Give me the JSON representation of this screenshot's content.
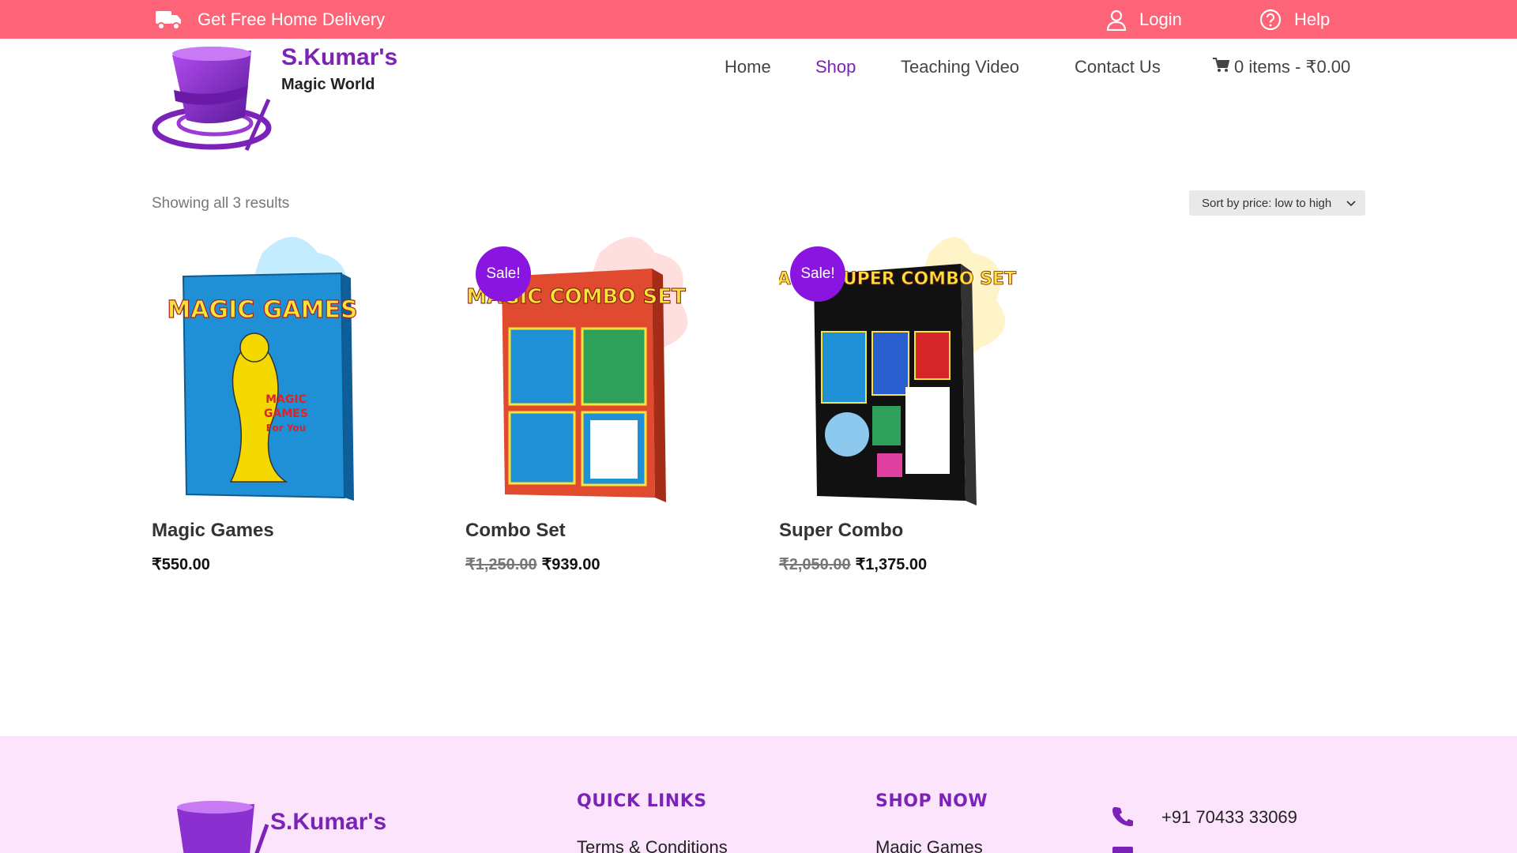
{
  "topbar": {
    "delivery_text": "Get Free Home Delivery",
    "login_label": "Login",
    "help_label": "Help",
    "background": "#fd6477"
  },
  "header": {
    "brand_name": "S.Kumar's",
    "brand_sub": "Magic World"
  },
  "nav": {
    "items": [
      "Home",
      "Shop",
      "Teaching Video",
      "Contact Us"
    ],
    "active": "Shop",
    "cart_label": "0 items - ₹0.00"
  },
  "shop": {
    "results_count": "Showing all 3 results",
    "sort_selected": "Sort by price: low to high"
  },
  "products": [
    {
      "name": "Magic Games",
      "price": "₹550.00",
      "old_price": "",
      "sale": false,
      "box_title": "MAGIC GAMES"
    },
    {
      "name": "Combo Set",
      "price": "₹939.00",
      "old_price": "₹1,250.00",
      "sale": true,
      "sale_label": "Sale!",
      "box_title": "MAGIC COMBO SET"
    },
    {
      "name": "Super Combo",
      "price": "₹1,375.00",
      "old_price": "₹2,050.00",
      "sale": true,
      "sale_label": "Sale!",
      "box_title": "MAGIC SUPER COMBO SET"
    }
  ],
  "footer": {
    "brand_name": "S.Kumar's",
    "quick_links_title": "QUICK LINKS",
    "quick_links": [
      "Terms & Conditions"
    ],
    "shop_now_title": "SHOP NOW",
    "shop_now_links": [
      "Magic Games"
    ],
    "phone": "+91 70433 33069"
  },
  "colors": {
    "accent": "#7b22b8",
    "sale_badge": "#8a14e0",
    "footer_bg": "#fce5fc"
  }
}
